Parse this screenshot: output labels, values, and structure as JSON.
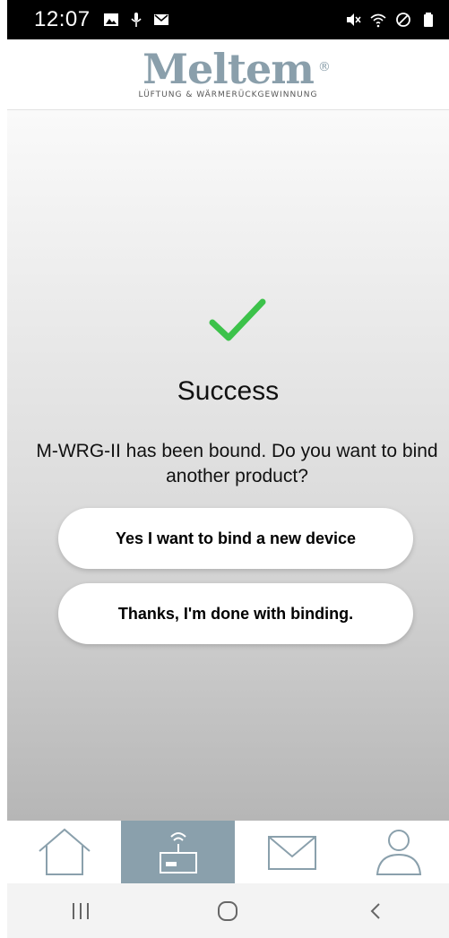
{
  "status_bar": {
    "time": "12:07",
    "left_icons": [
      "image-icon",
      "microphone-icon",
      "mail-icon"
    ],
    "right_icons": [
      "mute-icon",
      "wifi-icon",
      "do-not-disturb-icon",
      "battery-icon"
    ]
  },
  "header": {
    "logo_text": "Meltem",
    "logo_registered": "®",
    "logo_subtitle": "LÜFTUNG & WÄRMERÜCKGEWINNUNG"
  },
  "success": {
    "icon": "checkmark-icon",
    "title": "Success",
    "message": "M-WRG-II has been bound. Do you want to bind another product?",
    "yes_button": "Yes I want to bind a new device",
    "done_button": "Thanks, I'm done with binding."
  },
  "tab_bar": {
    "tabs": [
      {
        "icon": "home-icon",
        "active": false
      },
      {
        "icon": "router-icon",
        "active": true
      },
      {
        "icon": "mail-icon",
        "active": false
      },
      {
        "icon": "user-icon",
        "active": false
      }
    ]
  },
  "nav_bar": {
    "buttons": [
      "recent-apps-icon",
      "home-circle-icon",
      "back-icon"
    ]
  },
  "colors": {
    "accent": "#8aa0ac",
    "check": "#3cc24a",
    "status_bar": "#000000"
  }
}
